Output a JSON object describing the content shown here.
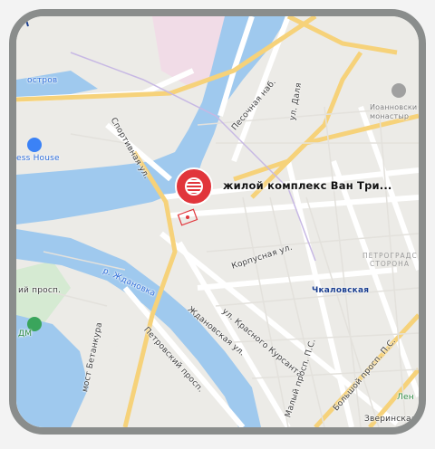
{
  "map": {
    "labels": {
      "ostrov": "остров",
      "sportivnaya": "Спортивная ул.",
      "pesochnaya": "Песочная наб.",
      "dalya": "ул. Даля",
      "ioannovsky": "Иоанновски монастыр",
      "house": "ess House",
      "complex": "жилой комплекс Ван Три...",
      "korpusnaya": "Корпусная ул.",
      "petrograd": "ПЕТРОГРАДС СТОРОНА",
      "metro": "Чкаловская",
      "zhdanovka": "р. Ждановка",
      "prosp": "ий просп.",
      "zhdanovskaya": "Ждановская ул.",
      "krasnogo": "ул. Красного Курсанта",
      "petrovsky": "Петровский просп.",
      "most": "мост Бетанкура",
      "dm": "ДМ",
      "bolshoy": "Большой просп. П.С.",
      "maly": "Малый просп. П.С.",
      "zverinskaya": "Зверинская ул.",
      "len": "Лен",
      "pc": "П.С."
    },
    "colors": {
      "water": "#9fc9ee",
      "land": "#ecebe7",
      "pin": "#e1353b",
      "metro": "#1a3e8f",
      "park": "#d5ead2"
    }
  }
}
